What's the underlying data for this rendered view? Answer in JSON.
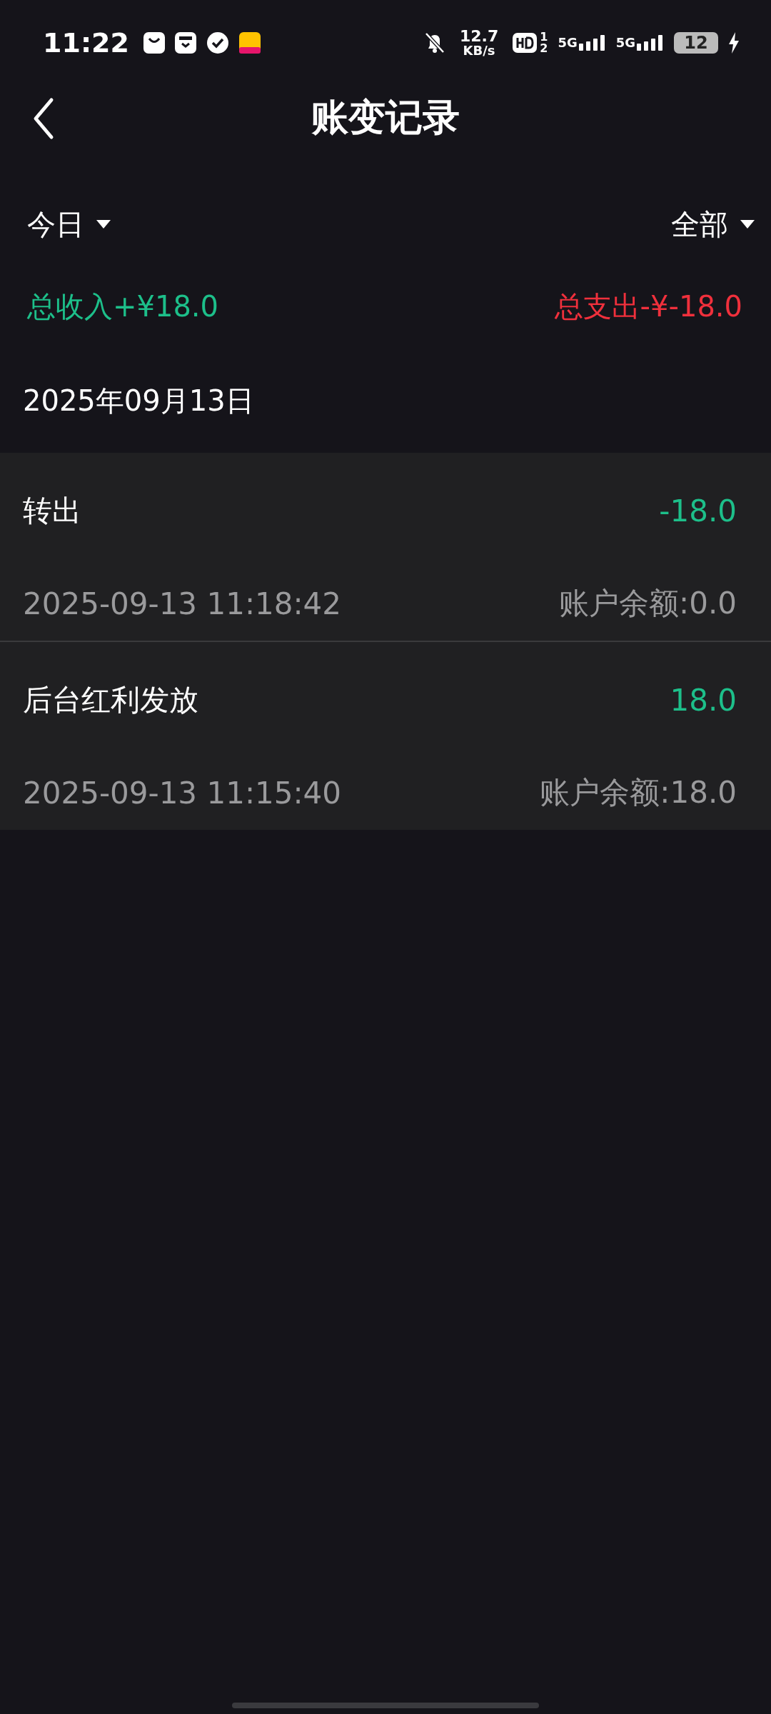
{
  "status_bar": {
    "time": "11:22",
    "speed": "12.7",
    "speed_unit": "KB/s",
    "hd_sim": [
      "1",
      "2"
    ],
    "networks": [
      "5G",
      "5G"
    ],
    "battery": "12",
    "charging": true
  },
  "header": {
    "title": "账变记录"
  },
  "filters": [
    {
      "label": "今日"
    },
    {
      "label": "全部"
    }
  ],
  "totals": {
    "income": "总收入+¥18.0",
    "expense": "总支出-¥-18.0"
  },
  "date": "2025年09月13日",
  "records": [
    {
      "title": "转出",
      "amount": "-18.0",
      "time": "2025-09-13 11:18:42",
      "balance": "账户余额:0.0"
    },
    {
      "title": "后台红利发放",
      "amount": "18.0",
      "time": "2025-09-13 11:15:40",
      "balance": "账户余额:18.0"
    }
  ]
}
